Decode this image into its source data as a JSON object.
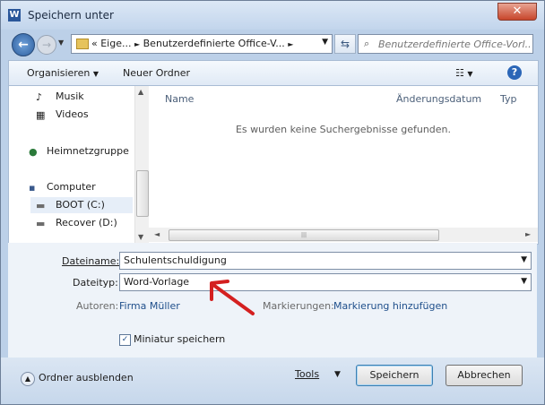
{
  "window": {
    "title": "Speichern unter",
    "app_icon": "W",
    "close_glyph": "✕"
  },
  "nav": {
    "back_glyph": "←",
    "forward_glyph": "→",
    "breadcrumb": [
      "«",
      "Eige...",
      "►",
      "Benutzerdefinierte Office-V...",
      "►"
    ],
    "search_placeholder": "Benutzerdefinierte Office-Vorl..."
  },
  "toolbar": {
    "organize": "Organisieren",
    "new_folder": "Neuer Ordner",
    "help": "?"
  },
  "navpane": {
    "items": [
      {
        "label": "Musik",
        "icon": "music-icon",
        "glyph": "♪"
      },
      {
        "label": "Videos",
        "icon": "video-icon",
        "glyph": "▦"
      },
      {
        "label": "Heimnetzgruppe",
        "icon": "homegroup-icon",
        "glyph": "●"
      },
      {
        "label": "Computer",
        "icon": "computer-icon",
        "glyph": "▪"
      },
      {
        "label": "BOOT (C:)",
        "icon": "drive-icon",
        "glyph": "▬"
      },
      {
        "label": "Recover (D:)",
        "icon": "drive-icon",
        "glyph": "▬"
      }
    ]
  },
  "filelist": {
    "columns": [
      "Name",
      "Änderungsdatum",
      "Typ"
    ],
    "empty_message": "Es wurden keine Suchergebnisse gefunden."
  },
  "form": {
    "filename_label": "Dateiname:",
    "filename_value": "Schulentschuldigung",
    "filetype_label": "Dateityp:",
    "filetype_value": "Word-Vorlage",
    "authors_label": "Autoren:",
    "authors_value": "Firma Müller",
    "tags_label": "Markierungen:",
    "tags_value": "Markierung hinzufügen",
    "thumbnail_label": "Miniatur speichern",
    "thumbnail_checked": true
  },
  "footer": {
    "hide_folders": "Ordner ausblenden",
    "tools": "Tools",
    "save": "Speichern",
    "cancel": "Abbrechen"
  },
  "colors": {
    "annotation_arrow": "#d42020",
    "accent": "#2b66b7"
  }
}
